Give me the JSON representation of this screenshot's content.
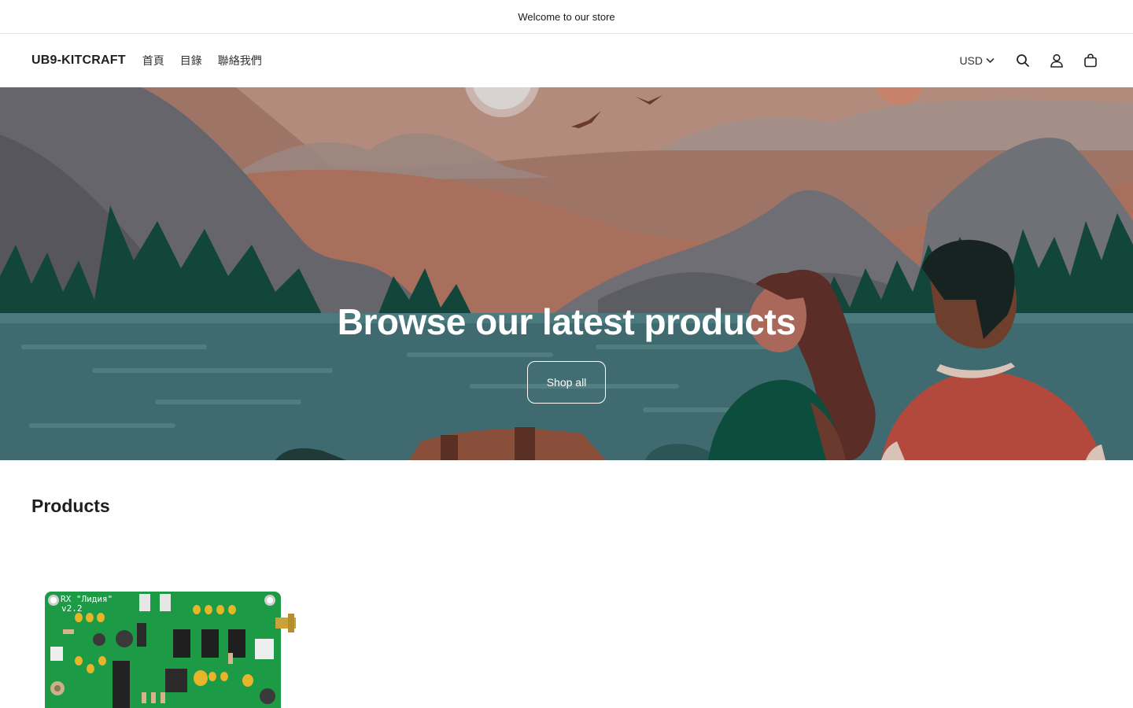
{
  "announcement": {
    "text": "Welcome to our store"
  },
  "header": {
    "logo": "UB9-KITCRAFT",
    "nav": [
      {
        "label": "首頁"
      },
      {
        "label": "目錄"
      },
      {
        "label": "聯絡我們"
      }
    ],
    "currency": "USD",
    "icons": [
      "search-icon",
      "account-icon",
      "cart-icon"
    ]
  },
  "hero": {
    "title": "Browse our latest products",
    "button_label": "Shop all"
  },
  "products": {
    "title": "Products",
    "items": [
      {
        "image_label_1": "RX \"Лидия\"",
        "image_label_2": "v2.2"
      }
    ]
  },
  "colors": {
    "text": "#222222",
    "border": "#e6e6e6",
    "sky": "#9e7466",
    "water": "#3f6b70",
    "pcb": "#1d9a45"
  }
}
